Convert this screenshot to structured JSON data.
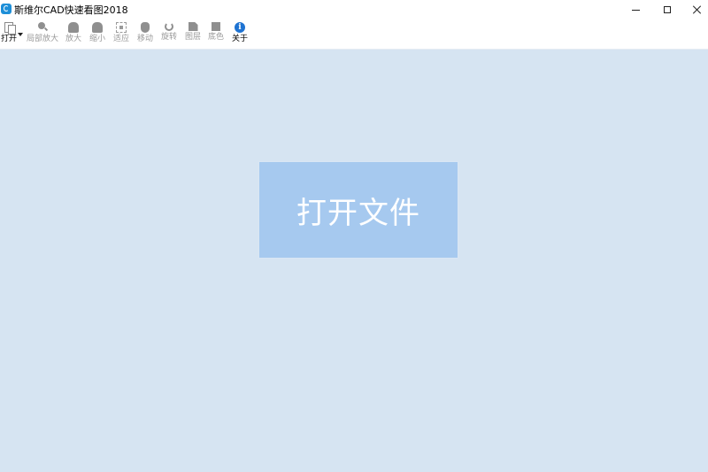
{
  "window": {
    "title": "斯维尔CAD快速看图2018",
    "controls": {
      "minimize": "minimize",
      "maximize": "maximize",
      "close": "close"
    }
  },
  "toolbar": {
    "items": [
      {
        "label": "打开",
        "icon": "open-file-icon",
        "enabled": true
      },
      {
        "label": "局部放大",
        "icon": "zoom-window-icon",
        "enabled": false
      },
      {
        "label": "放大",
        "icon": "zoom-in-icon",
        "enabled": false
      },
      {
        "label": "缩小",
        "icon": "zoom-out-icon",
        "enabled": false
      },
      {
        "label": "适应",
        "icon": "fit-view-icon",
        "enabled": false
      },
      {
        "label": "移动",
        "icon": "pan-hand-icon",
        "enabled": false
      },
      {
        "label": "旋转",
        "icon": "rotate-icon",
        "enabled": false
      },
      {
        "label": "图层",
        "icon": "layers-icon",
        "enabled": false
      },
      {
        "label": "底色",
        "icon": "background-color-icon",
        "enabled": false
      },
      {
        "label": "关于",
        "icon": "info-icon",
        "enabled": true
      }
    ]
  },
  "canvas": {
    "open_button_label": "打开文件",
    "background_color": "#d6e4f2",
    "button_color": "#a6c9ef"
  }
}
